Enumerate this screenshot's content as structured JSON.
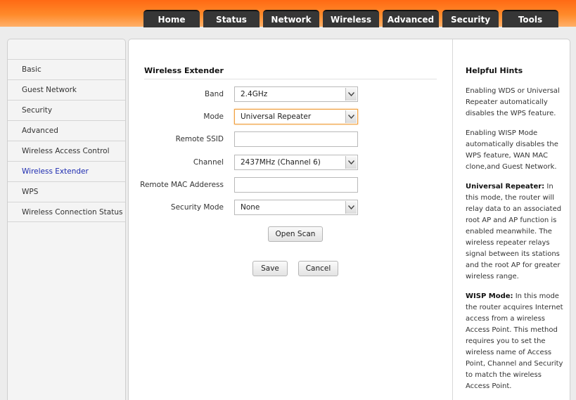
{
  "nav": {
    "tabs": [
      "Home",
      "Status",
      "Network",
      "Wireless",
      "Advanced",
      "Security",
      "Tools"
    ]
  },
  "sidebar": {
    "items": [
      {
        "label": "Basic"
      },
      {
        "label": "Guest Network"
      },
      {
        "label": "Security"
      },
      {
        "label": "Advanced"
      },
      {
        "label": "Wireless Access Control"
      },
      {
        "label": "Wireless Extender"
      },
      {
        "label": "WPS"
      },
      {
        "label": "Wireless Connection Status"
      }
    ],
    "active": "Wireless Extender"
  },
  "main": {
    "title": "Wireless Extender",
    "fields": {
      "band": {
        "label": "Band",
        "value": "2.4GHz"
      },
      "mode": {
        "label": "Mode",
        "value": "Universal Repeater"
      },
      "remote_ssid": {
        "label": "Remote SSID",
        "value": ""
      },
      "channel": {
        "label": "Channel",
        "value": "2437MHz (Channel 6)"
      },
      "remote_mac": {
        "label": "Remote MAC Adderess",
        "value": ""
      },
      "security_mode": {
        "label": "Security Mode",
        "value": "None"
      }
    },
    "buttons": {
      "open_scan": "Open Scan",
      "save": "Save",
      "cancel": "Cancel"
    }
  },
  "hints": {
    "title": "Helpful Hints",
    "p1": "Enabling WDS or Universal Repeater automatically disables the WPS feature.",
    "p2": "Enabling WISP Mode automatically disables the WPS feature, WAN MAC clone,and Guest Network.",
    "p3_bold": "Universal Repeater:",
    "p3_text": " In this mode, the router will relay data to an associated root AP and AP function is enabled meanwhile. The wireless repeater relays signal between its stations and the root AP for greater wireless range.",
    "p4_bold": "WISP Mode:",
    "p4_text": " In this mode the router acquires Internet access from a wireless Access Point. This method requires you to set the wireless name of Access Point, Channel and Security to match the wireless Access Point."
  }
}
